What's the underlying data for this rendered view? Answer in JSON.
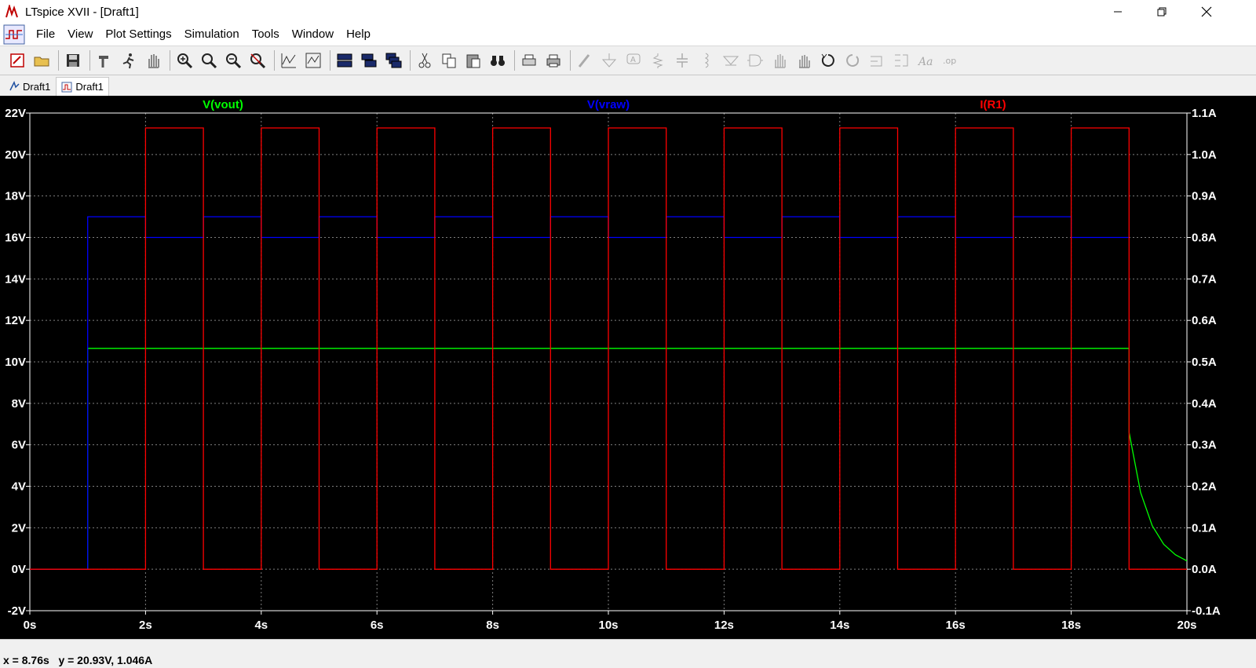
{
  "window": {
    "title": "LTspice XVII - [Draft1]",
    "minimize": "—",
    "maximize": "❐",
    "close": "✕"
  },
  "menu": {
    "items": [
      "File",
      "View",
      "Plot Settings",
      "Simulation",
      "Tools",
      "Window",
      "Help"
    ],
    "mdi_minimize": "–",
    "mdi_restore": "▫",
    "mdi_close": "✕"
  },
  "toolbar": {
    "buttons": [
      "new-schematic",
      "open",
      "save",
      "control-panel",
      "run",
      "halt",
      "zoom-in",
      "zoom-full",
      "zoom-out",
      "zoom-cancel",
      "autorange",
      "plot-settings",
      "tile-horizontal",
      "tile-vertical",
      "cascade",
      "cut",
      "copy",
      "paste",
      "find",
      "print-preview",
      "print",
      "draw-wire",
      "ground",
      "label-net",
      "resistor",
      "capacitor",
      "inductor",
      "diode",
      "component",
      "move",
      "drag",
      "undo",
      "redo",
      "rotate",
      "mirror",
      "text",
      "spice-directive"
    ]
  },
  "tabs": [
    {
      "label": "Draft1",
      "icon": "schematic-icon",
      "active": false
    },
    {
      "label": "Draft1",
      "icon": "waveform-icon",
      "active": true
    }
  ],
  "status": {
    "text": "x = 8.76s   y = 20.93V, 1.046A"
  },
  "colors": {
    "vout": "#00ff00",
    "vraw": "#0000ff",
    "ir1": "#ff0000",
    "axis": "#ffffff",
    "grid": "#7f7f7f",
    "background": "#000000"
  },
  "chart_data": {
    "type": "line",
    "title": "",
    "xlabel": "",
    "ylabel": "",
    "xlim": [
      0,
      20
    ],
    "ylim_left": [
      -2,
      22
    ],
    "ylim_right": [
      -0.1,
      1.1
    ],
    "grid": true,
    "x_ticks": [
      "0s",
      "2s",
      "4s",
      "6s",
      "8s",
      "10s",
      "12s",
      "14s",
      "16s",
      "18s",
      "20s"
    ],
    "y_ticks_left": [
      "22V",
      "20V",
      "18V",
      "16V",
      "14V",
      "12V",
      "10V",
      "8V",
      "6V",
      "4V",
      "2V",
      "0V",
      "-2V"
    ],
    "y_ticks_right": [
      "1.1A",
      "1.0A",
      "0.9A",
      "0.8A",
      "0.7A",
      "0.6A",
      "0.5A",
      "0.4A",
      "0.3A",
      "0.2A",
      "0.1A",
      "0.0A",
      "-0.1A"
    ],
    "series": [
      {
        "name": "V(vout)",
        "axis": "left",
        "x": [
          0,
          1,
          1,
          19,
          19,
          19.2,
          19.4,
          19.6,
          19.8,
          20
        ],
        "y": [
          0,
          0,
          10.65,
          10.65,
          6.6,
          3.7,
          2.1,
          1.2,
          0.7,
          0.4
        ]
      },
      {
        "name": "V(vraw)",
        "axis": "left",
        "x": [
          0,
          1,
          1,
          2,
          2,
          3,
          3,
          4,
          4,
          5,
          5,
          6,
          6,
          7,
          7,
          8,
          8,
          9,
          9,
          10,
          10,
          11,
          11,
          12,
          12,
          13,
          13,
          14,
          14,
          15,
          15,
          16,
          16,
          17,
          17,
          18,
          18,
          19
        ],
        "y": [
          0,
          0,
          17,
          17,
          16,
          16,
          17,
          17,
          16,
          16,
          17,
          17,
          16,
          16,
          17,
          17,
          16,
          16,
          17,
          17,
          16,
          16,
          17,
          17,
          16,
          16,
          17,
          17,
          16,
          16,
          17,
          17,
          16,
          16,
          17,
          17,
          16,
          16
        ]
      },
      {
        "name": "I(R1)",
        "axis": "right",
        "x": [
          0,
          2,
          2,
          3,
          3,
          4,
          4,
          5,
          5,
          6,
          6,
          7,
          7,
          8,
          8,
          9,
          9,
          10,
          10,
          11,
          11,
          12,
          12,
          13,
          13,
          14,
          14,
          15,
          15,
          16,
          16,
          17,
          17,
          18,
          18,
          19,
          19,
          20
        ],
        "y": [
          0,
          0,
          1.064,
          1.064,
          0,
          0,
          1.064,
          1.064,
          0,
          0,
          1.064,
          1.064,
          0,
          0,
          1.064,
          1.064,
          0,
          0,
          1.064,
          1.064,
          0,
          0,
          1.064,
          1.064,
          0,
          0,
          1.064,
          1.064,
          0,
          0,
          1.064,
          1.064,
          0,
          0,
          1.064,
          1.064,
          0,
          0
        ]
      }
    ]
  }
}
